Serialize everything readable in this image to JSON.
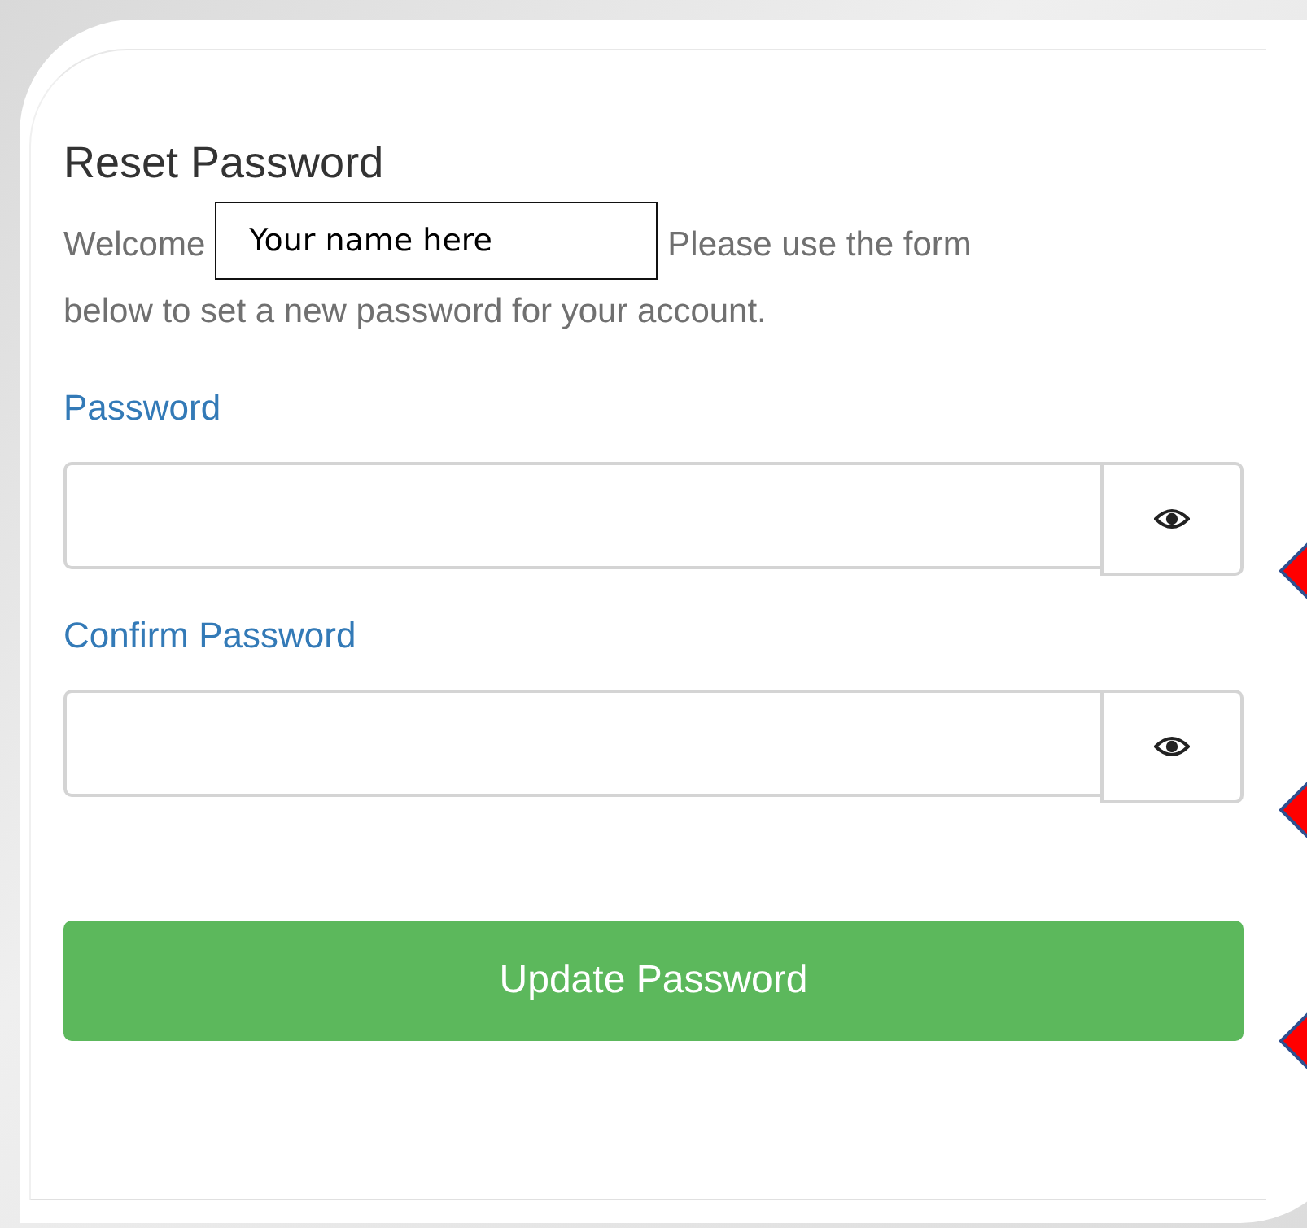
{
  "form": {
    "title": "Reset Password",
    "welcome_before": "Welcome",
    "name_box": "Your name here",
    "welcome_after": [
      "Please use the form",
      "below to set a new password for your account."
    ],
    "fields": [
      {
        "label": "Password"
      },
      {
        "label": "Confirm Password"
      }
    ],
    "submit_button": "Update Password"
  }
}
